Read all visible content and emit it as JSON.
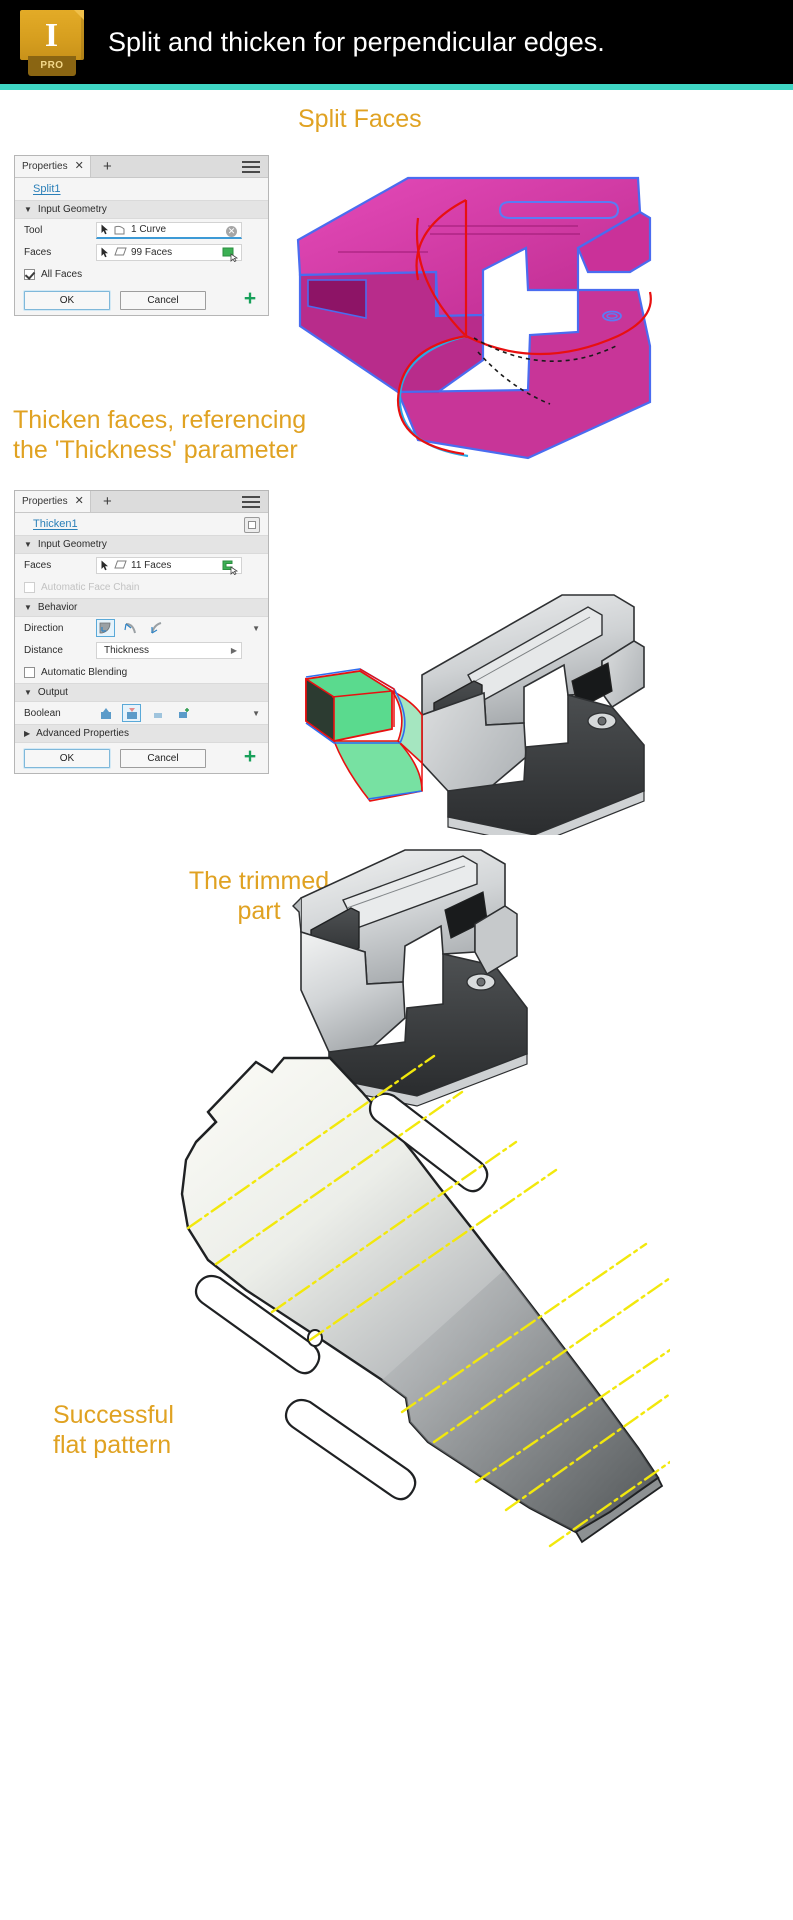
{
  "header": {
    "title": "Split and thicken for perpendicular edges.",
    "logo_letter": "I",
    "logo_badge": "PRO",
    "accent_color": "#3fd6c4",
    "brand_color": "#d79f1f",
    "background": "#000000"
  },
  "annotations": {
    "split_faces": "Split Faces",
    "thicken": "Thicken faces, referencing\nthe 'Thickness' parameter",
    "trimmed": "The trimmed\npart",
    "flat_pattern": "Successful\nflat pattern",
    "color": "#e0a222"
  },
  "split_panel": {
    "tab_label": "Properties",
    "close_glyph": "✕",
    "add_glyph": "+",
    "feature_name": "Split1",
    "sections": [
      {
        "label": "Input Geometry",
        "caret": "▼"
      }
    ],
    "rows": {
      "tool": {
        "label": "Tool",
        "value": "1 Curve",
        "clear_glyph": "✕"
      },
      "faces": {
        "label": "Faces",
        "value": "99 Faces"
      },
      "all_faces": {
        "label": "All Faces",
        "checked": true
      }
    },
    "buttons": {
      "ok": "OK",
      "cancel": "Cancel",
      "add": "+"
    }
  },
  "thicken_panel": {
    "tab_label": "Properties",
    "close_glyph": "✕",
    "add_glyph": "+",
    "feature_name": "Thicken1",
    "sections": {
      "input_geometry": {
        "label": "Input Geometry",
        "caret": "▼"
      },
      "behavior": {
        "label": "Behavior",
        "caret": "▼"
      },
      "output": {
        "label": "Output",
        "caret": "▼"
      },
      "advanced": {
        "label": "Advanced Properties",
        "caret": "▶"
      }
    },
    "rows": {
      "faces": {
        "label": "Faces",
        "value": "11 Faces"
      },
      "auto_face_chain": {
        "label": "Automatic Face Chain",
        "checked": false,
        "disabled": true
      },
      "direction": {
        "label": "Direction",
        "selected_index": 0,
        "options": [
          "one-side",
          "symmetric",
          "two-side"
        ]
      },
      "distance": {
        "label": "Distance",
        "value": "Thickness"
      },
      "auto_blending": {
        "label": "Automatic Blending",
        "checked": false
      },
      "boolean": {
        "label": "Boolean",
        "selected_index": 1,
        "options": [
          "join",
          "cut",
          "intersect",
          "new-body"
        ]
      }
    },
    "buttons": {
      "ok": "OK",
      "cancel": "Cancel",
      "add": "+"
    }
  },
  "figures": {
    "split_model": {
      "name": "split-faces-3d-model",
      "face_color": "#d0219a",
      "edge_color": "#4a6cf0",
      "curve_color": "#e81010"
    },
    "thicken_model": {
      "name": "thicken-3d-model",
      "face_color": "#c9cbcd",
      "highlight_color": "#3dd47a"
    },
    "trimmed_model": {
      "name": "trimmed-part-3d-model",
      "face_color": "#c9cbcd"
    },
    "flat_pattern": {
      "name": "flat-pattern-3d-model",
      "bend_line_color": "#f2e80c"
    }
  }
}
